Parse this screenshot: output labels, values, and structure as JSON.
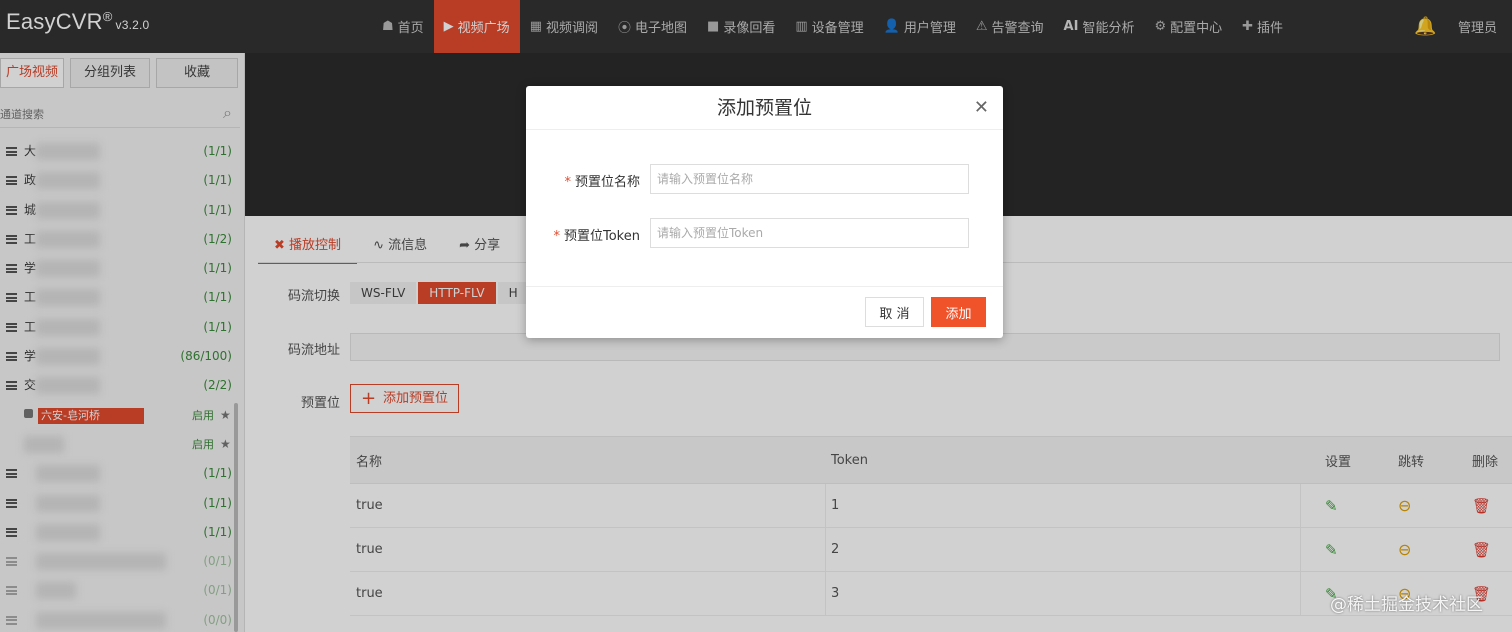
{
  "app": {
    "logo": "EasyCVR",
    "reg": "®",
    "version": "v3.2.0"
  },
  "nav": [
    {
      "label": "首页",
      "icon": "☗"
    },
    {
      "label": "视频广场",
      "icon": "▶"
    },
    {
      "label": "视频调阅",
      "icon": "▦"
    },
    {
      "label": "电子地图",
      "icon": "⦿"
    },
    {
      "label": "录像回看",
      "icon": "■"
    },
    {
      "label": "设备管理",
      "icon": "▥"
    },
    {
      "label": "用户管理",
      "icon": "👤"
    },
    {
      "label": "告警查询",
      "icon": "⚠"
    },
    {
      "label": "智能分析",
      "icon": "AI"
    },
    {
      "label": "配置中心",
      "icon": "⚙"
    },
    {
      "label": "插件",
      "icon": "✚"
    }
  ],
  "header": {
    "bell_icon": "bell-icon",
    "user": "管理员"
  },
  "sidebar": {
    "tabs": [
      "广场视频",
      "分组列表",
      "收藏"
    ],
    "search_placeholder": "通道搜索",
    "tree": [
      {
        "name": "大",
        "count": "(1/1)"
      },
      {
        "name": "政",
        "count": "(1/1)"
      },
      {
        "name": "城",
        "count": "(1/1)"
      },
      {
        "name": "工",
        "count": "(1/2)"
      },
      {
        "name": "学",
        "count": "(1/1)"
      },
      {
        "name": "工",
        "count": "(1/1)"
      },
      {
        "name": "工",
        "count": "(1/1)"
      },
      {
        "name": "学",
        "count": "(86/100)"
      },
      {
        "name": "交",
        "count": "(2/2)"
      }
    ],
    "sub_items": [
      {
        "name": "六安-皂河桥",
        "status": "启用"
      },
      {
        "name": "",
        "status": "启用"
      }
    ],
    "tree_more": [
      {
        "count": "(1/1)"
      },
      {
        "count": "(1/1)"
      },
      {
        "count": "(1/1)"
      },
      {
        "count": "(0/1)"
      },
      {
        "count": "(0/1)"
      },
      {
        "count": "(0/0)"
      }
    ]
  },
  "content": {
    "tabs": [
      "播放控制",
      "流信息",
      "分享"
    ],
    "tab_icons": [
      "✖",
      "∿",
      "➦"
    ],
    "stream_label": "码流切换",
    "stream_options": [
      "WS-FLV",
      "HTTP-FLV",
      "H"
    ],
    "address_label": "码流地址",
    "preset_label": "预置位",
    "add_preset_button": "添加预置位",
    "table": {
      "headers": {
        "name": "名称",
        "token": "Token",
        "settings": "设置",
        "jump": "跳转",
        "delete": "删除"
      },
      "rows": [
        {
          "name": "true",
          "token": "1"
        },
        {
          "name": "true",
          "token": "2"
        },
        {
          "name": "true",
          "token": "3"
        }
      ]
    }
  },
  "modal": {
    "title": "添加预置位",
    "name_label": "预置位名称",
    "name_placeholder": "请输入预置位名称",
    "name_value": "",
    "token_label": "预置位Token",
    "token_placeholder": "请输入预置位Token",
    "token_value": "",
    "cancel": "取 消",
    "submit": "添加"
  },
  "watermark": "@稀土掘金技术社区",
  "colors": {
    "accent": "#e24a2e",
    "topbar": "#333333",
    "success": "#3ba33b",
    "warning": "#e0a000"
  }
}
